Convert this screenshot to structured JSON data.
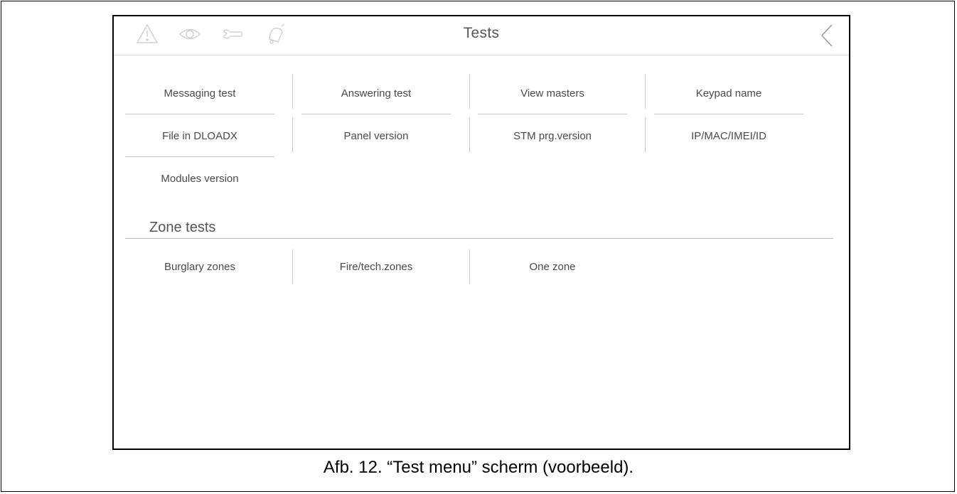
{
  "header": {
    "title": "Tests"
  },
  "icons": [
    "alarm-icon",
    "eye-icon",
    "wrench-icon",
    "bell-icon"
  ],
  "tests": [
    "Messaging test",
    "Answering test",
    "View masters",
    "Keypad name",
    "File in DLOADX",
    "Panel version",
    "STM prg.version",
    "IP/MAC/IMEI/ID",
    "Modules version"
  ],
  "zone_tests": {
    "title": "Zone tests",
    "items": [
      "Burglary zones",
      "Fire/tech.zones",
      "One zone"
    ]
  },
  "caption": "Afb. 12. “Test menu” scherm (voorbeeld)."
}
